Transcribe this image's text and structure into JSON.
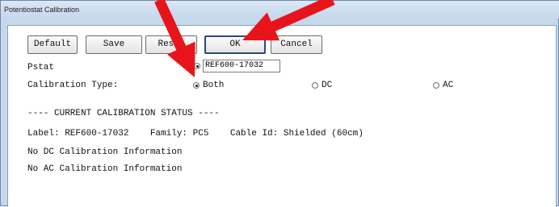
{
  "window": {
    "title": "Potentiostat Calibration"
  },
  "toolbar": {
    "default_label": "Default",
    "save_label": "Save",
    "reset_label": "Reset",
    "ok_label": "OK",
    "cancel_label": "Cancel"
  },
  "form": {
    "pstat_label": "Pstat",
    "pstat_value": "REF600-17032",
    "calibration_type_label": "Calibration Type:",
    "options": [
      {
        "label": "Both",
        "selected": true
      },
      {
        "label": "DC",
        "selected": false
      },
      {
        "label": "AC",
        "selected": false
      }
    ]
  },
  "status": {
    "header": "---- CURRENT CALIBRATION STATUS ----",
    "label_line": "Label: REF600-17032    Family: PC5    Cable Id: Shielded (60cm)",
    "dc_line": "No DC Calibration Information",
    "ac_line": "No AC Calibration Information"
  },
  "colors": {
    "arrow": "#e8141c"
  }
}
